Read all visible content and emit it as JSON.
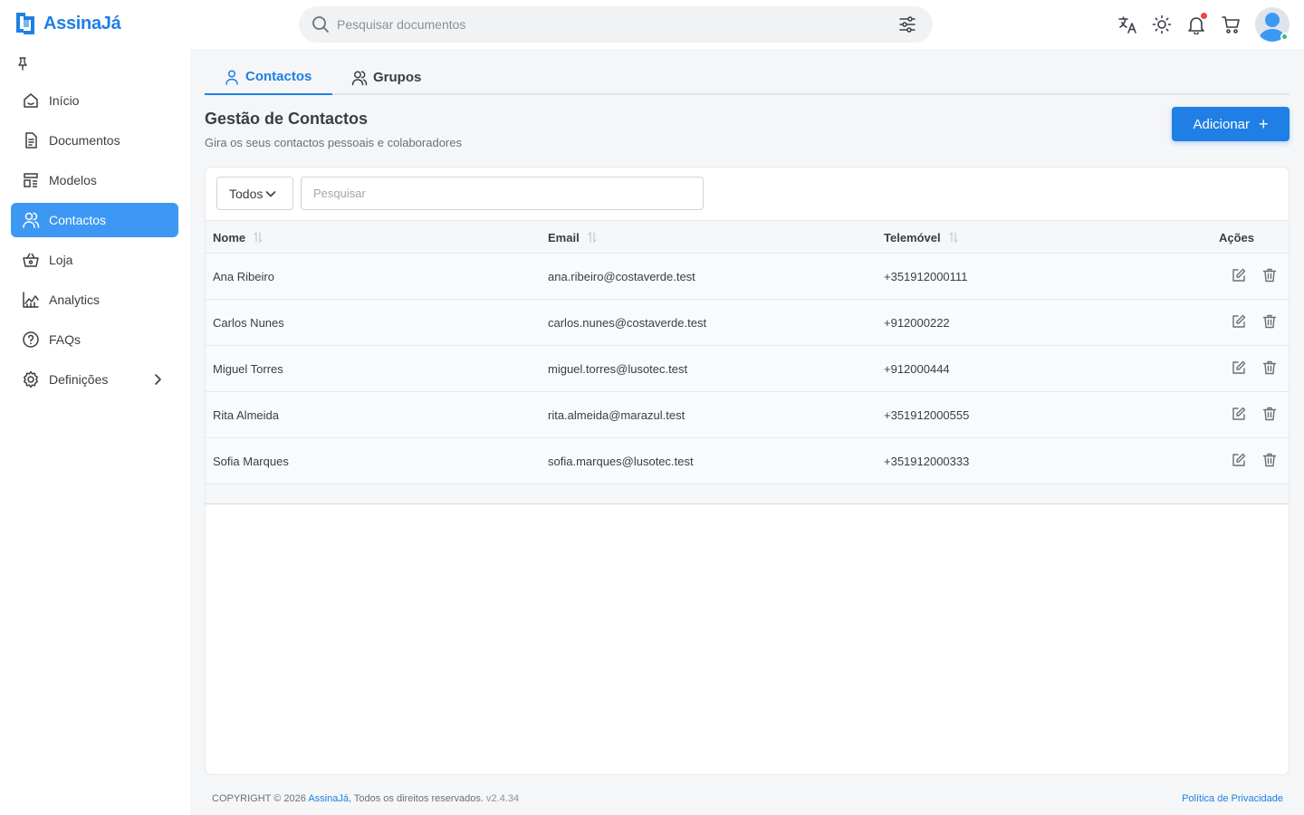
{
  "app": {
    "brand": "AssinaJá"
  },
  "header": {
    "search_placeholder": "Pesquisar documentos"
  },
  "sidebar": {
    "items": [
      {
        "label": "Início",
        "icon": "home-icon"
      },
      {
        "label": "Documentos",
        "icon": "document-icon"
      },
      {
        "label": "Modelos",
        "icon": "template-icon"
      },
      {
        "label": "Contactos",
        "icon": "users-icon",
        "active": true
      },
      {
        "label": "Loja",
        "icon": "basket-icon"
      },
      {
        "label": "Analytics",
        "icon": "chart-icon"
      },
      {
        "label": "FAQs",
        "icon": "help-icon"
      },
      {
        "label": "Definições",
        "icon": "gear-icon"
      }
    ]
  },
  "tabs": [
    {
      "label": "Contactos",
      "active": true
    },
    {
      "label": "Grupos"
    }
  ],
  "page": {
    "title": "Gestão de Contactos",
    "subtitle": "Gira os seus contactos pessoais e colaboradores",
    "add_label": "Adicionar"
  },
  "table": {
    "filter_value": "Todos",
    "search_placeholder": "Pesquisar",
    "headers": {
      "name": "Nome",
      "email": "Email",
      "phone": "Telemóvel",
      "actions": "Ações"
    },
    "rows": [
      {
        "name": "Ana Ribeiro",
        "email": "ana.ribeiro@costaverde.test",
        "phone": "+351912000111"
      },
      {
        "name": "Carlos Nunes",
        "email": "carlos.nunes@costaverde.test",
        "phone": "+912000222"
      },
      {
        "name": "Miguel Torres",
        "email": "miguel.torres@lusotec.test",
        "phone": "+912000444"
      },
      {
        "name": "Rita Almeida",
        "email": "rita.almeida@marazul.test",
        "phone": "+351912000555"
      },
      {
        "name": "Sofia Marques",
        "email": "sofia.marques@lusotec.test",
        "phone": "+351912000333"
      }
    ]
  },
  "footer": {
    "copyright": "COPYRIGHT © 2026 ",
    "brand": "AssinaJá",
    "rights": ", Todos os direitos reservados.",
    "version": "v2.4.34",
    "privacy": "Política de Privacidade"
  },
  "colors": {
    "accent": "#1f7fe5",
    "active_nav": "#3d98f4",
    "notification": "#f0434b",
    "online": "#2ec27e"
  }
}
